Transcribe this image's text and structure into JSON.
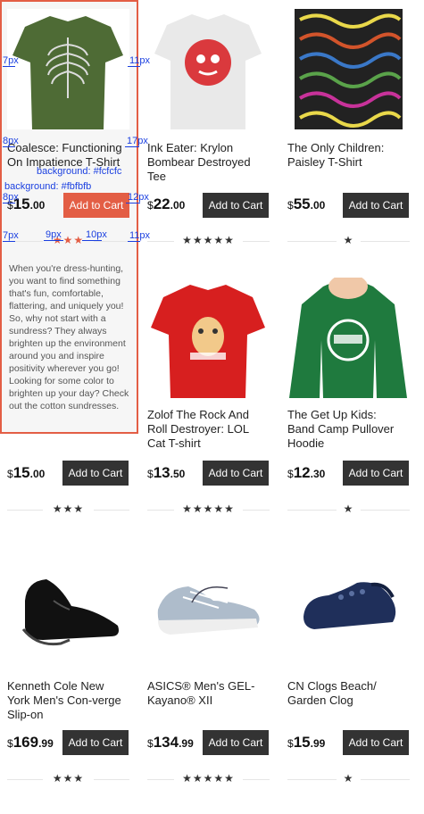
{
  "products": [
    {
      "title": "Coalesce: Functioning On Impatience T-Shirt",
      "currency": "$",
      "price_int": "15",
      "price_dec": ".00",
      "cart": "Add to Cart",
      "stars": "★★★",
      "img": "tshirt-ribcage"
    },
    {
      "title": "Ink Eater: Krylon Bombear Destroyed Tee",
      "currency": "$",
      "price_int": "22",
      "price_dec": ".00",
      "cart": "Add to Cart",
      "stars": "★★★★★",
      "img": "tshirt-bear"
    },
    {
      "title": "The Only Children: Paisley T-Shirt",
      "currency": "$",
      "price_int": "55",
      "price_dec": ".00",
      "cart": "Add to Cart",
      "stars": "★",
      "img": "tshirt-paisley"
    },
    {
      "title": "",
      "currency": "$",
      "price_int": "15",
      "price_dec": ".00",
      "cart": "Add to Cart",
      "stars": "★★★",
      "img": ""
    },
    {
      "title": "Zolof The Rock And Roll Destroyer: LOL Cat T-shirt",
      "currency": "$",
      "price_int": "13",
      "price_dec": ".50",
      "cart": "Add to Cart",
      "stars": "★★★★★",
      "img": "tshirt-cat"
    },
    {
      "title": "The Get Up Kids: Band Camp Pullover Hoodie",
      "currency": "$",
      "price_int": "12",
      "price_dec": ".30",
      "cart": "Add to Cart",
      "stars": "★",
      "img": "hoodie-green"
    },
    {
      "title": "Kenneth Cole New York Men's Con-verge Slip-on",
      "currency": "$",
      "price_int": "169",
      "price_dec": ".99",
      "cart": "Add to Cart",
      "stars": "★★★",
      "img": "shoe-black"
    },
    {
      "title": "ASICS® Men's GEL-Kayano® XII",
      "currency": "$",
      "price_int": "134",
      "price_dec": ".99",
      "cart": "Add to Cart",
      "stars": "★★★★★",
      "img": "sneaker-grey"
    },
    {
      "title": "CN Clogs Beach/ Garden Clog",
      "currency": "$",
      "price_int": "15",
      "price_dec": ".99",
      "cart": "Add to Cart",
      "stars": "★",
      "img": "clog-navy"
    }
  ],
  "featured_description": "When you're dress-hunting, you want to find something that's fun, comfortable, flattering, and uniquely you! So, why not start with a sundress? They always brighten up the environment around you and inspire positivity wherever you go! Looking for some color to brighten up your day? Check out the cotton sundresses.",
  "annotations": {
    "a1": "7px",
    "a2": "11px",
    "a3": "8px",
    "a4": "17px",
    "a5": "background: #fcfcfc",
    "a6": "background: #fbfbfb",
    "a7": "8px",
    "a8": "12px",
    "a9": "7px",
    "a10": "9px",
    "a11": "10px",
    "a12": "11px"
  },
  "colors": {
    "accent": "#e35e45",
    "button": "#333333",
    "annotation": "#1a3fe0"
  }
}
